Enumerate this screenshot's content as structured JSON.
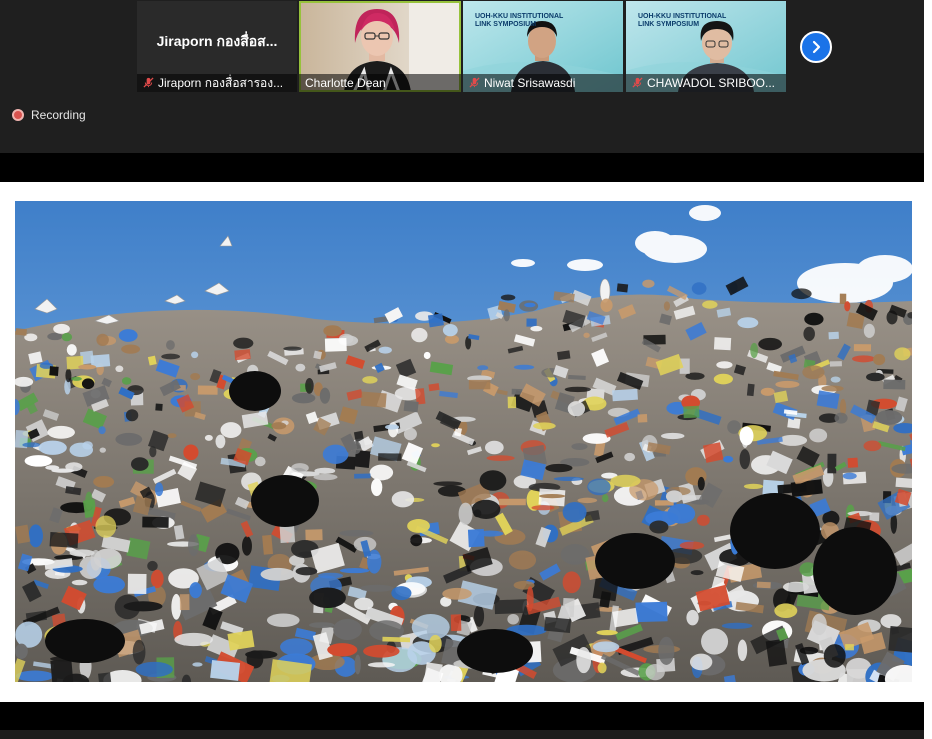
{
  "participants": [
    {
      "tile_label": "Jiraporn กองสื่อส...",
      "name": "Jiraporn กองสื่อสารอง...",
      "muted": true
    },
    {
      "name": "Charlotte Dean",
      "muted": false
    },
    {
      "name": "Niwat Srisawasdi",
      "muted": true,
      "banner": "UOH-KKU INSTITUTIONAL LINK SYMPOSIUM"
    },
    {
      "name": "CHAWADOL SRIBOO...",
      "muted": true,
      "banner": "UOH-KKU INSTITUTIONAL LINK SYMPOSIUM"
    }
  ],
  "recording": {
    "label": "Recording"
  },
  "icons": {
    "next": "chevron-right-icon",
    "mic": "mic-off-icon",
    "record": "record-dot-icon"
  },
  "colors": {
    "accent": "#1a73e8",
    "speaking": "#97c23b",
    "record": "#d9534f"
  },
  "slide": {
    "image": "landfill-garbage-photo"
  }
}
